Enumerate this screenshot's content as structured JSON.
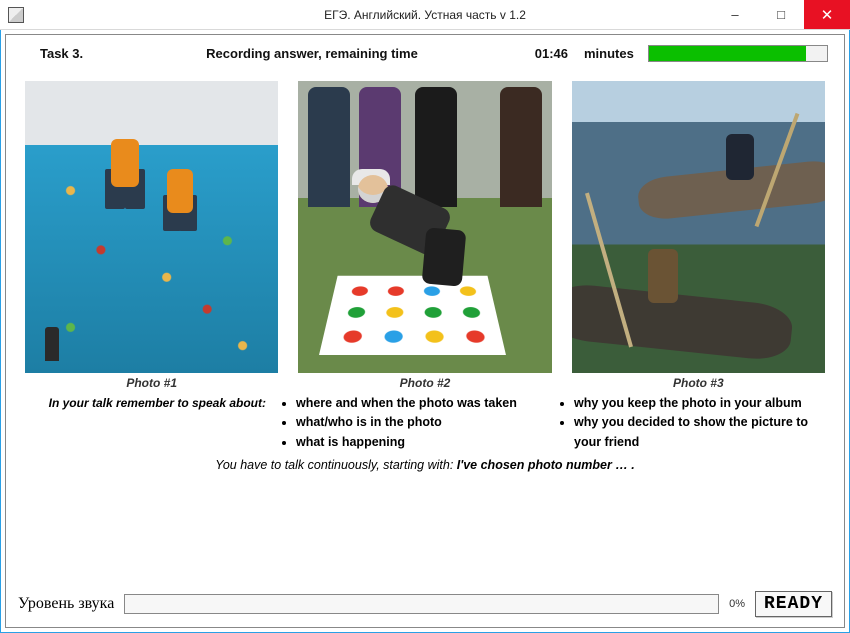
{
  "window": {
    "title": "ЕГЭ. Английский. Устная часть v 1.2",
    "controls": {
      "minimize": "–",
      "maximize": "□",
      "close": "✕"
    }
  },
  "status": {
    "task_label": "Task 3.",
    "status_text": "Recording answer, remaining time",
    "time": "01:46",
    "unit": "minutes",
    "progress_percent": 88
  },
  "photos": {
    "captions": [
      "Photo #1",
      "Photo #2",
      "Photo #3"
    ],
    "alts": [
      "Indoor climbing wall with two climbers",
      "People playing Twister outdoors on grass",
      "Two people kayaking on a lake"
    ]
  },
  "instructions": {
    "lead": "In your talk remember to speak about:",
    "col1": [
      "where  and  when  the  photo was  taken",
      "what/who is in the photo",
      "what is happening"
    ],
    "col2": [
      "why you keep the photo in your album",
      "why you decided to show the picture to your friend"
    ],
    "starter_prefix": "You have to talk continuously, starting with: ",
    "starter_bold": "I've chosen photo number … ."
  },
  "footer": {
    "level_label": "Уровень звука",
    "level_percent": "0%",
    "ready_label": "READY"
  }
}
